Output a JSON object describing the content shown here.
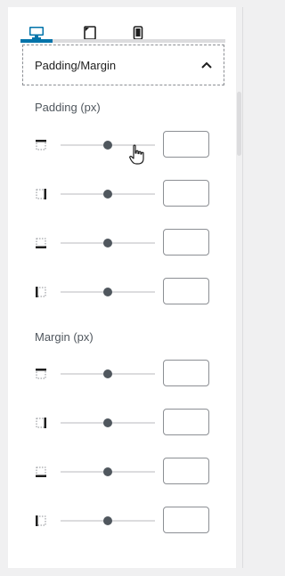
{
  "tabs": [
    {
      "name": "desktop",
      "icon": "desktop-icon",
      "active": true
    },
    {
      "name": "tablet",
      "icon": "tablet-icon",
      "active": false
    },
    {
      "name": "mobile",
      "icon": "mobile-icon",
      "active": false
    }
  ],
  "accent_color": "#0073aa",
  "accordion": {
    "title": "Padding/Margin",
    "icon": "chevron-up-icon",
    "expanded": true
  },
  "padding": {
    "label": "Padding (px)",
    "rows": [
      {
        "side": "top",
        "value": "",
        "slider": 0.5
      },
      {
        "side": "right",
        "value": "",
        "slider": 0.5
      },
      {
        "side": "bottom",
        "value": "",
        "slider": 0.5
      },
      {
        "side": "left",
        "value": "",
        "slider": 0.5
      }
    ]
  },
  "margin": {
    "label": "Margin (px)",
    "rows": [
      {
        "side": "top",
        "value": "",
        "slider": 0.5
      },
      {
        "side": "right",
        "value": "",
        "slider": 0.5
      },
      {
        "side": "bottom",
        "value": "",
        "slider": 0.5
      },
      {
        "side": "left",
        "value": "",
        "slider": 0.5
      }
    ]
  }
}
